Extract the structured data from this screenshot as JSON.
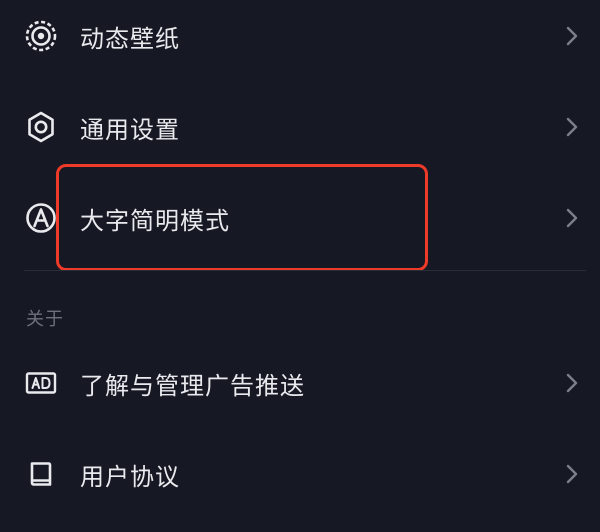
{
  "settings": {
    "items": [
      {
        "label": "动态壁纸",
        "icon": "live-wallpaper-icon"
      },
      {
        "label": "通用设置",
        "icon": "gear-icon"
      },
      {
        "label": "大字简明模式",
        "icon": "large-font-icon"
      }
    ]
  },
  "about": {
    "title": "关于",
    "items": [
      {
        "label": "了解与管理广告推送",
        "icon": "ad-icon"
      },
      {
        "label": "用户协议",
        "icon": "book-icon"
      }
    ]
  },
  "colors": {
    "background": "#161823",
    "text": "#e9eaee",
    "muted": "#6e717c",
    "highlight": "#ee3a28"
  }
}
